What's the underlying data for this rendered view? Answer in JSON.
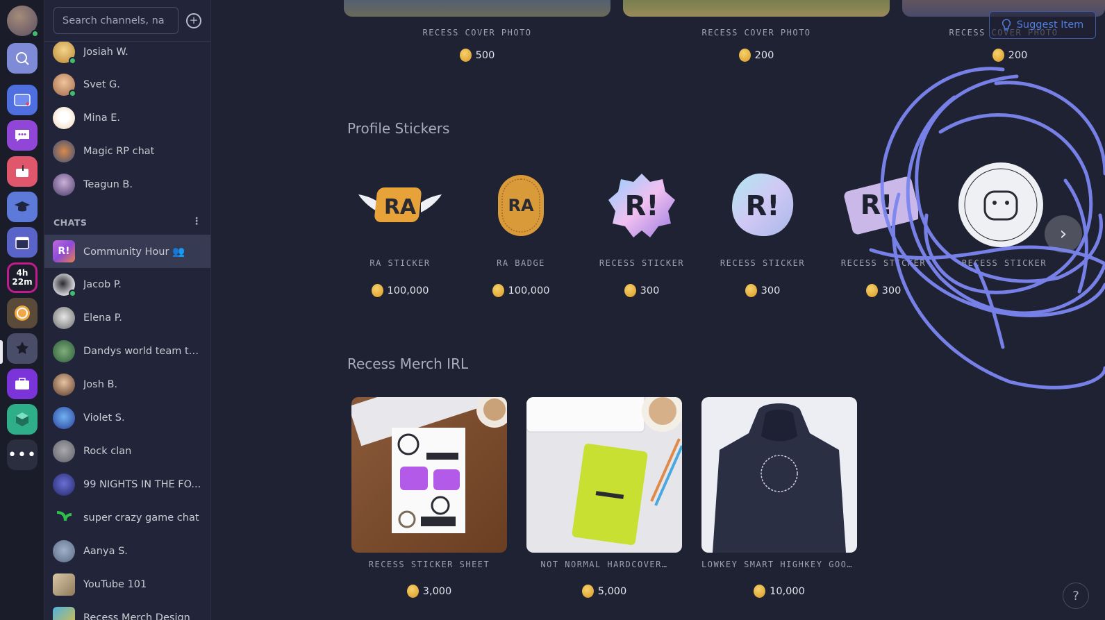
{
  "rail": {
    "timer": {
      "hours": "4h",
      "minutes": "22m"
    },
    "more": "•••"
  },
  "sidebar": {
    "search": {
      "placeholder": "Search channels, na",
      "value": ""
    },
    "add_icon": "+",
    "contacts": [
      {
        "name": "Josiah W.",
        "online": true
      },
      {
        "name": "Svet G.",
        "online": true
      },
      {
        "name": "Mina E.",
        "online": false
      },
      {
        "name": "Magic RP chat",
        "online": false
      },
      {
        "name": "Teagun B.",
        "online": false
      }
    ],
    "chats_header": "CHATS",
    "chats_menu": "⋮",
    "community_badge": "R!",
    "chats": [
      {
        "name": "Community Hour 👥",
        "selected": true
      },
      {
        "name": "Jacob P.",
        "online": true
      },
      {
        "name": "Elena P."
      },
      {
        "name": "Dandys world team th..."
      },
      {
        "name": "Josh B."
      },
      {
        "name": "Violet S."
      },
      {
        "name": "Rock clan"
      },
      {
        "name": "99 NIGHTS IN THE FO..."
      },
      {
        "name": "super crazy game chat"
      },
      {
        "name": "Aanya S."
      },
      {
        "name": "YouTube 101"
      },
      {
        "name": "Recess Merch Design"
      }
    ]
  },
  "main": {
    "suggest_button": "Suggest Item",
    "cover_photos": [
      {
        "title": "RECESS COVER PHOTO",
        "price": "500"
      },
      {
        "title": "RECESS COVER PHOTO",
        "price": "200"
      },
      {
        "title": "RECESS COVER PHOTO",
        "price": "200"
      }
    ],
    "profile_stickers": {
      "title": "Profile Stickers",
      "items": [
        {
          "title": "RA STICKER",
          "price": "100,000",
          "art": "RA"
        },
        {
          "title": "RA BADGE",
          "price": "100,000",
          "art": "RA"
        },
        {
          "title": "RECESS STICKER",
          "price": "300",
          "art": "R!"
        },
        {
          "title": "RECESS STICKER",
          "price": "300",
          "art": "R!"
        },
        {
          "title": "RECESS STICKER",
          "price": "300",
          "art": "R!"
        },
        {
          "title": "RECESS STICKER",
          "price": "",
          "art": ""
        }
      ]
    },
    "merch": {
      "title": "Recess Merch IRL",
      "items": [
        {
          "title": "RECESS STICKER SHEET",
          "price": "3,000"
        },
        {
          "title": "NOT NORMAL HARDCOVER…",
          "price": "5,000"
        },
        {
          "title": "LOWKEY SMART HIGHKEY GOOF…",
          "price": "10,000"
        }
      ]
    },
    "carousel_next": "›",
    "help": "?"
  },
  "colors": {
    "background": "#1f2233",
    "sidebar": "#22253a",
    "selected_row": "#363a52",
    "coin": "#e0a630",
    "accent": "#4f7de0",
    "scribble": "#7b86f0"
  }
}
